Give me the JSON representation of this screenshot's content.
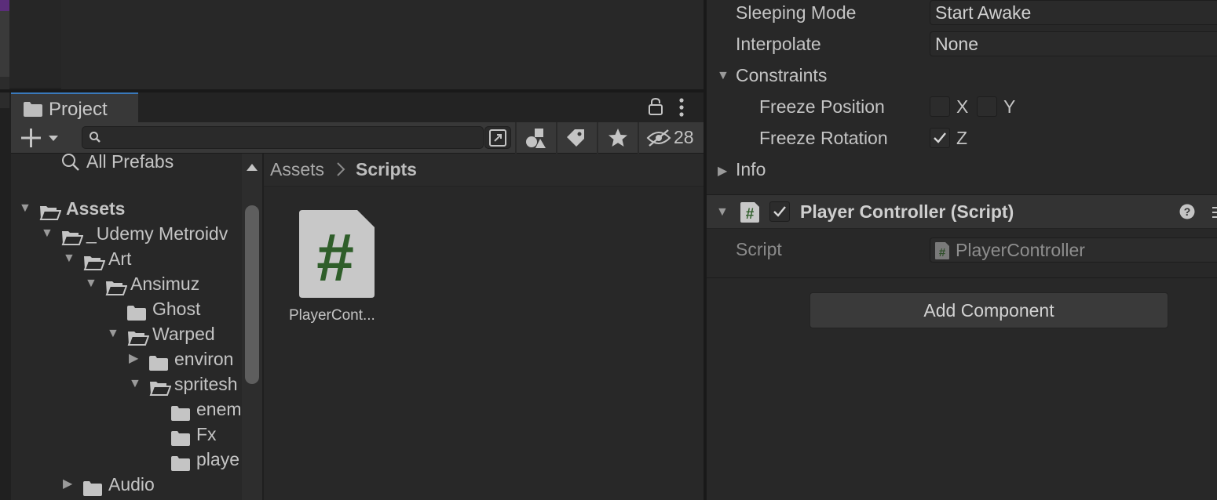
{
  "project": {
    "tab_label": "Project",
    "hidden_count": "28",
    "search_placeholder": ""
  },
  "tree": {
    "all_prefabs": "All Prefabs",
    "items": [
      {
        "label": "Assets",
        "bold": true
      },
      {
        "label": "_Udemy Metroidv"
      },
      {
        "label": "Art"
      },
      {
        "label": "Ansimuz"
      },
      {
        "label": "Ghost"
      },
      {
        "label": "Warped"
      },
      {
        "label": "environ"
      },
      {
        "label": "spritesh"
      },
      {
        "label": "enem"
      },
      {
        "label": "Fx"
      },
      {
        "label": "playe"
      },
      {
        "label": "Audio"
      }
    ]
  },
  "breadcrumb": {
    "root": "Assets",
    "current": "Scripts"
  },
  "assets": [
    {
      "name": "PlayerCont..."
    }
  ],
  "inspector": {
    "sleeping_mode_label": "Sleeping Mode",
    "sleeping_mode_value": "Start Awake",
    "interpolate_label": "Interpolate",
    "interpolate_value": "None",
    "constraints_label": "Constraints",
    "freeze_position_label": "Freeze Position",
    "freeze_rotation_label": "Freeze Rotation",
    "axis_x": "X",
    "axis_y": "Y",
    "axis_z": "Z",
    "info_label": "Info",
    "component_title": "Player Controller (Script)",
    "script_label": "Script",
    "script_value": "PlayerController",
    "add_component": "Add Component"
  },
  "colors": {
    "accent": "#3a79bb",
    "script_icon_green": "#2f5e2a"
  }
}
